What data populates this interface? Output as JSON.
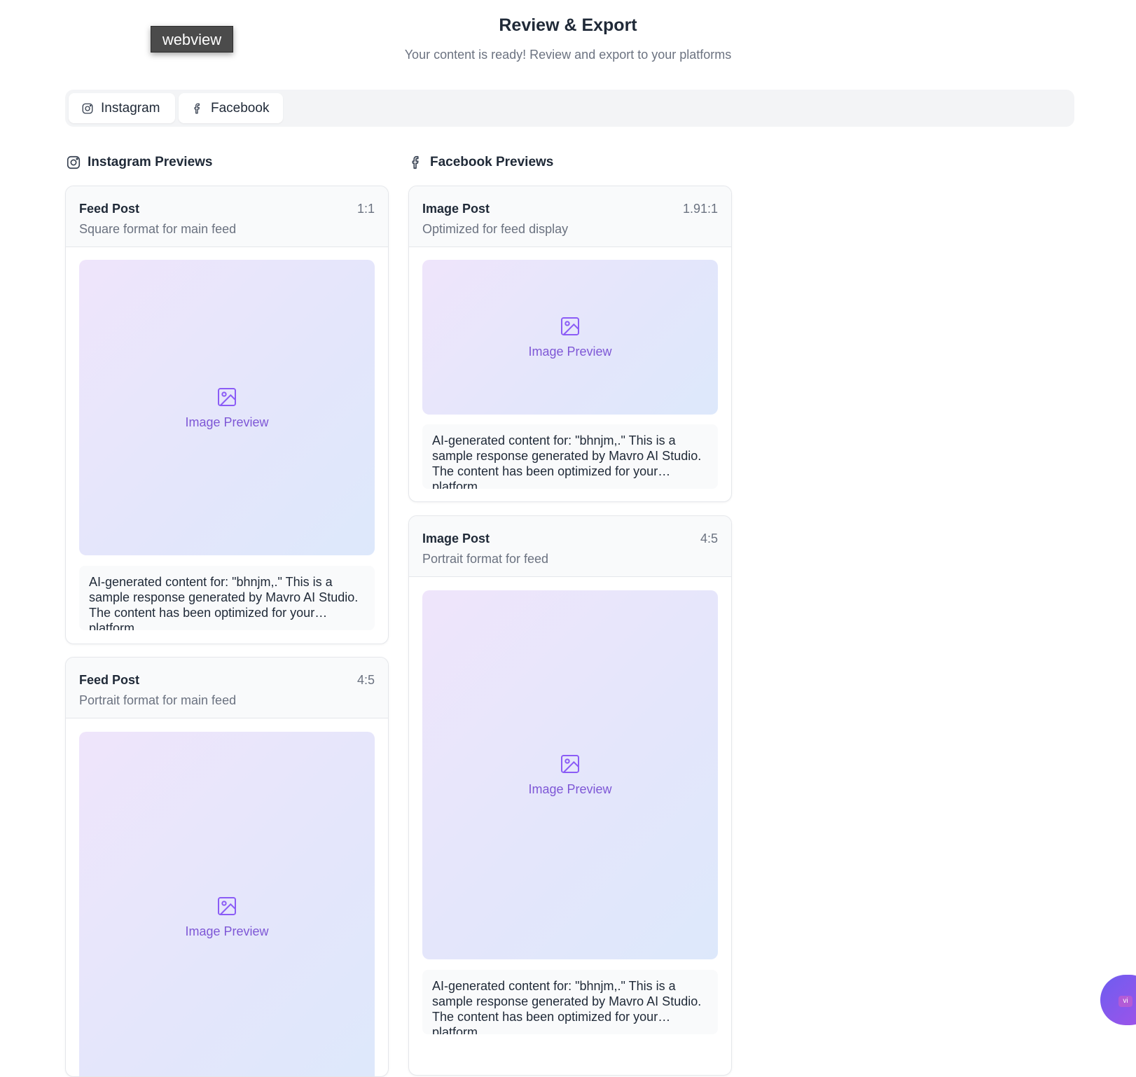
{
  "webview_label": "webview",
  "header": {
    "title": "Review & Export",
    "subtitle": "Your content is ready! Review and export to your platforms"
  },
  "tabs": [
    {
      "label": "Instagram",
      "icon": "instagram-icon"
    },
    {
      "label": "Facebook",
      "icon": "facebook-icon"
    }
  ],
  "instagram": {
    "section_title": "Instagram Previews",
    "cards": [
      {
        "title": "Feed Post",
        "subtitle": "Square format for main feed",
        "ratio": "1:1",
        "preview_label": "Image Preview",
        "caption": "AI-generated content for: \"bhnjm,.\" This is a sample response generated by Mavro AI Studio. The content has been optimized for your platform."
      },
      {
        "title": "Feed Post",
        "subtitle": "Portrait format for main feed",
        "ratio": "4:5",
        "preview_label": "Image Preview"
      }
    ]
  },
  "facebook": {
    "section_title": "Facebook Previews",
    "cards": [
      {
        "title": "Image Post",
        "subtitle": "Optimized for feed display",
        "ratio": "1.91:1",
        "preview_label": "Image Preview",
        "caption": "AI-generated content for: \"bhnjm,.\" This is a sample response generated by Mavro AI Studio. The content has been optimized for your platform."
      },
      {
        "title": "Image Post",
        "subtitle": "Portrait format for feed",
        "ratio": "4:5",
        "preview_label": "Image Preview",
        "caption": "AI-generated content for: \"bhnjm,.\" This is a sample response generated by Mavro AI Studio. The content has been optimized for your platform."
      }
    ]
  },
  "fab_label": "vi",
  "colors": {
    "accent": "#7e57d6",
    "fab": "#6d5df0"
  }
}
